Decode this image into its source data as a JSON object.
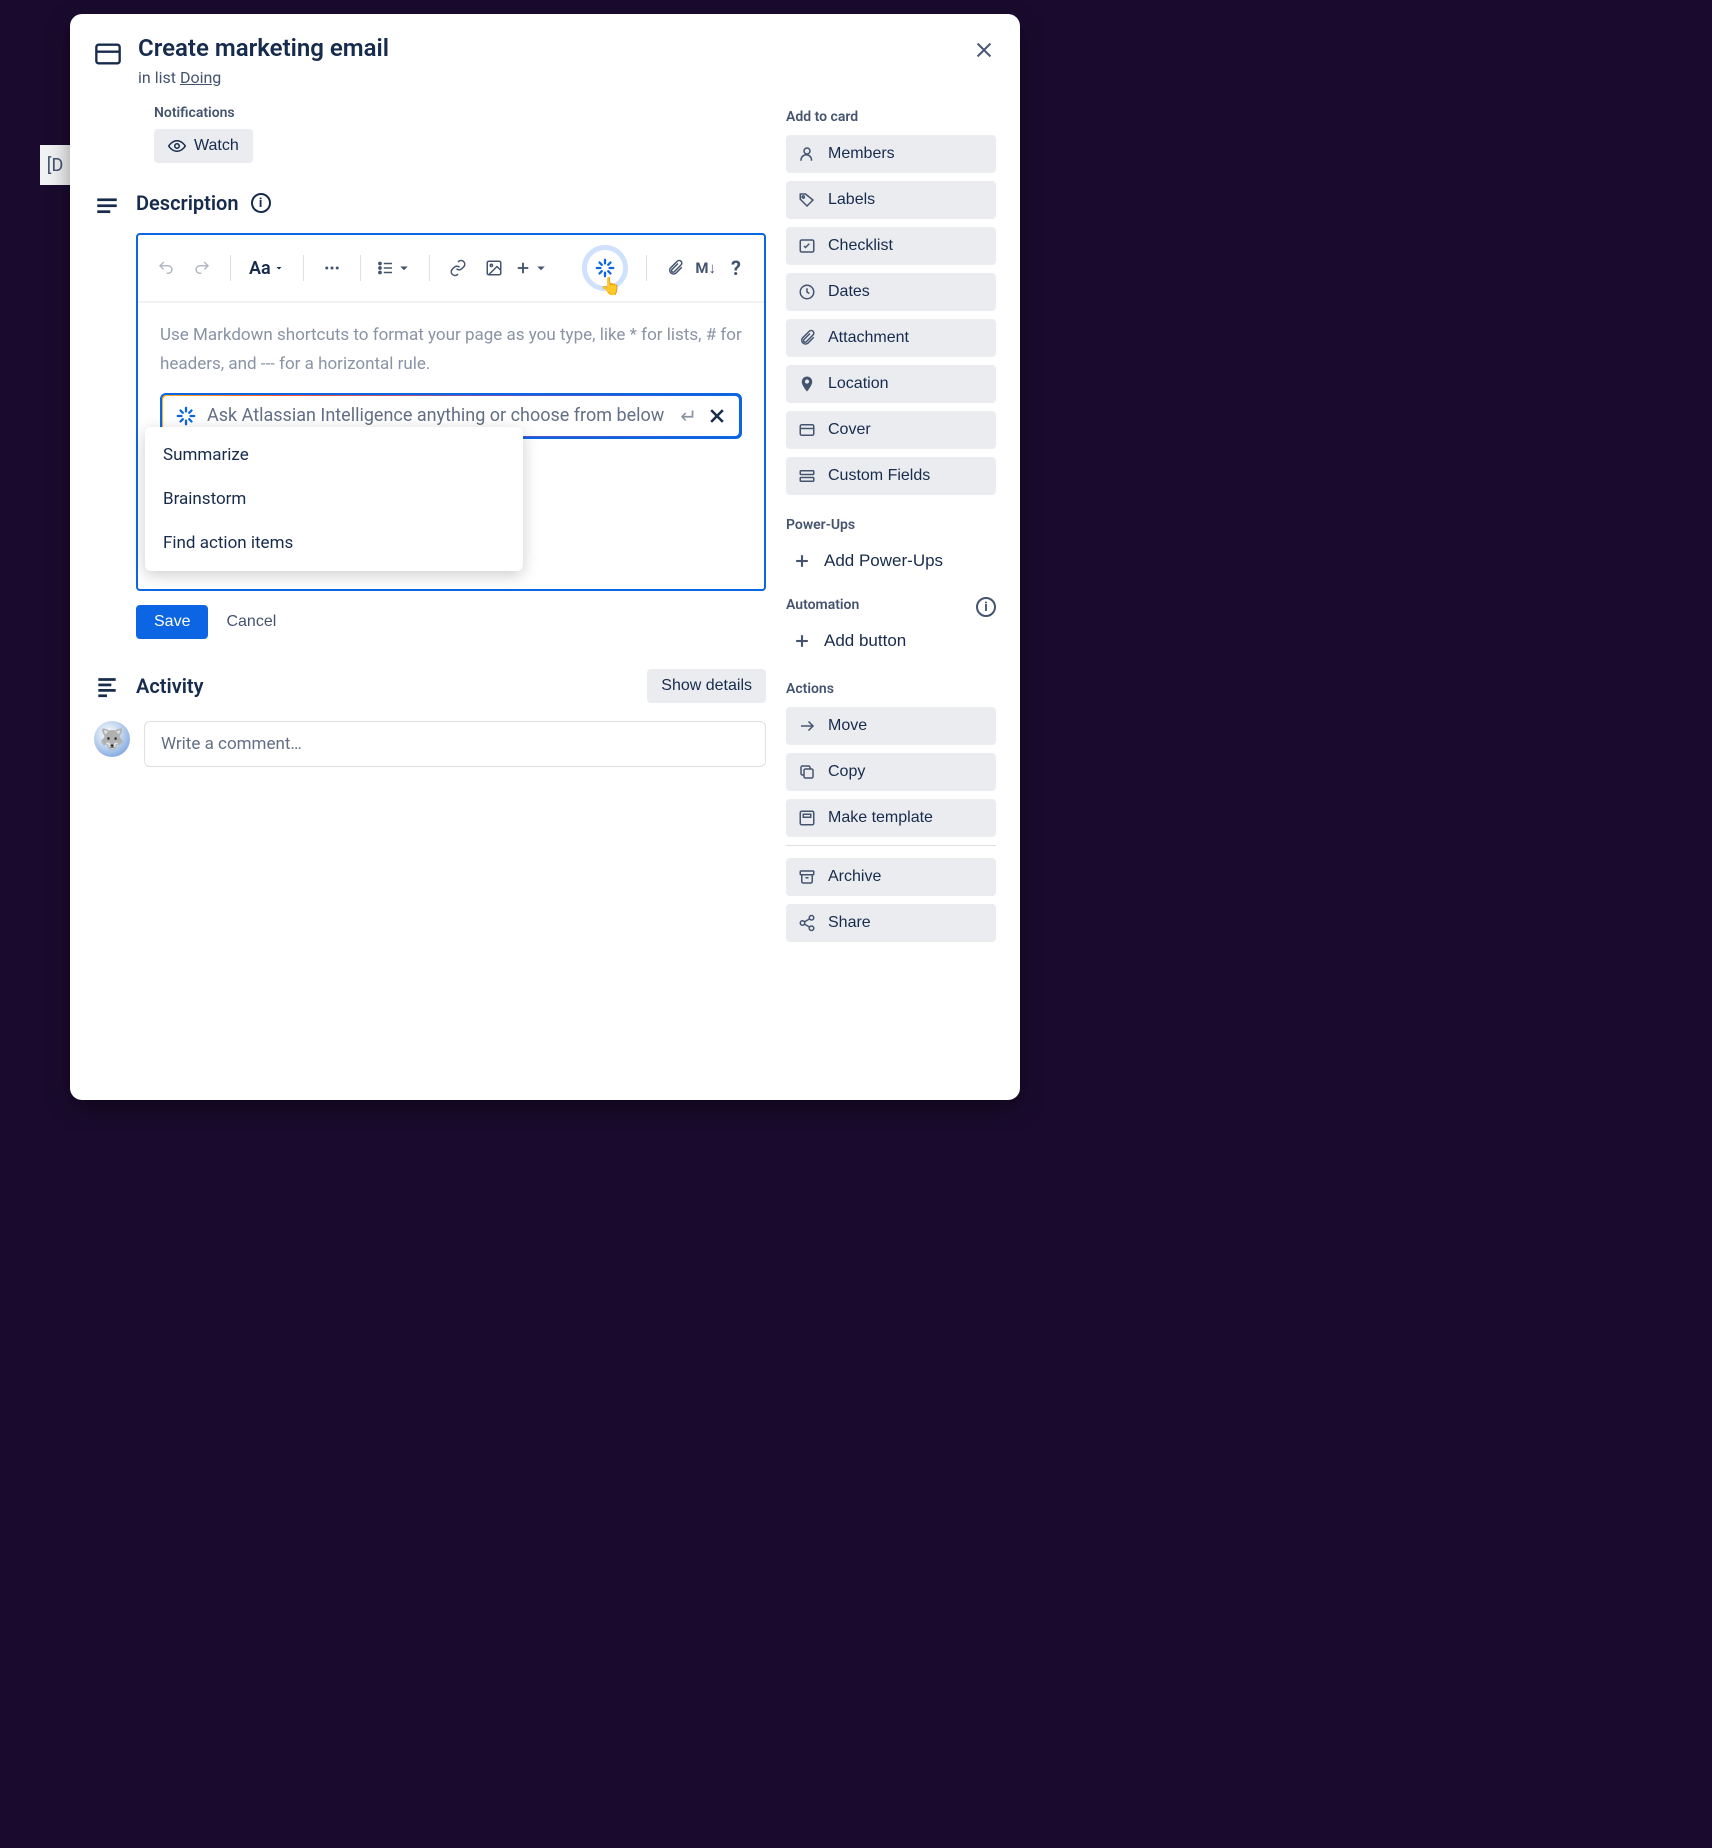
{
  "bgLeftText": "[D",
  "card": {
    "title": "Create marketing email",
    "inListPrefix": "in list ",
    "listName": "Doing"
  },
  "notifications": {
    "label": "Notifications",
    "watch": "Watch"
  },
  "description": {
    "title": "Description",
    "toolbar": {
      "textStyle": "Aa"
    },
    "placeholder": "Use Markdown shortcuts to format your page as you type, like * for lists, # for headers, and --- for a horizontal rule.",
    "ai": {
      "placeholder": "Ask Atlassian Intelligence anything or choose from below",
      "submitGlyph": "↵",
      "menu": [
        "Summarize",
        "Brainstorm",
        "Find action items"
      ]
    },
    "save": "Save",
    "cancel": "Cancel"
  },
  "activity": {
    "title": "Activity",
    "showDetails": "Show details",
    "commentPlaceholder": "Write a comment…"
  },
  "sidebar": {
    "addToCard": {
      "title": "Add to card",
      "items": [
        "Members",
        "Labels",
        "Checklist",
        "Dates",
        "Attachment",
        "Location",
        "Cover",
        "Custom Fields"
      ]
    },
    "powerUps": {
      "title": "Power-Ups",
      "add": "Add Power-Ups"
    },
    "automation": {
      "title": "Automation",
      "addButton": "Add button"
    },
    "actions": {
      "title": "Actions",
      "items": [
        "Move",
        "Copy",
        "Make template",
        "Archive",
        "Share"
      ]
    }
  }
}
